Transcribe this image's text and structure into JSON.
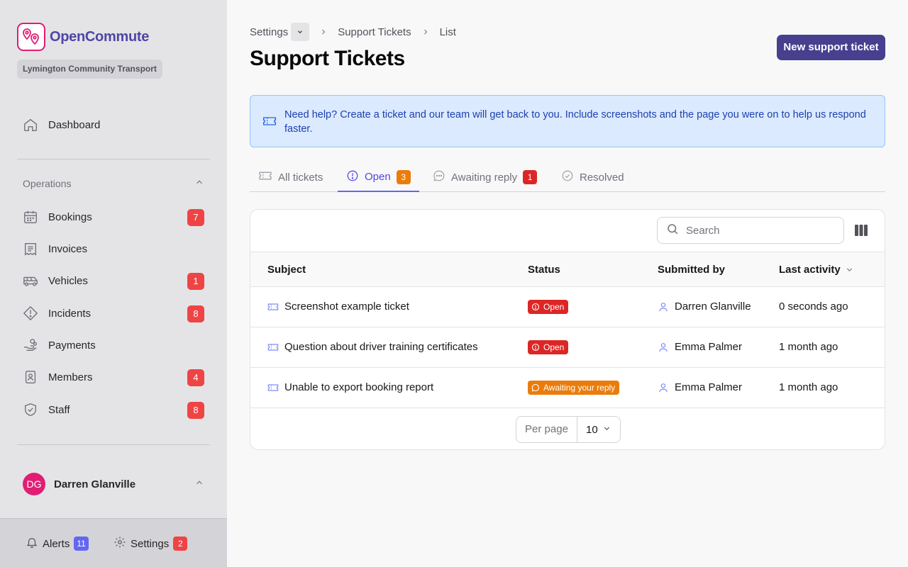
{
  "app": {
    "name": "OpenCommute",
    "organization": "Lymington Community Transport"
  },
  "sidebar": {
    "dashboard": {
      "label": "Dashboard"
    },
    "section_title": "Operations",
    "items": [
      {
        "label": "Bookings",
        "badge": "7"
      },
      {
        "label": "Invoices",
        "badge": ""
      },
      {
        "label": "Vehicles",
        "badge": "1"
      },
      {
        "label": "Incidents",
        "badge": "8"
      },
      {
        "label": "Payments",
        "badge": ""
      },
      {
        "label": "Members",
        "badge": "4"
      },
      {
        "label": "Staff",
        "badge": "8"
      }
    ],
    "user": {
      "initials": "DG",
      "name": "Darren Glanville"
    },
    "footer": {
      "alerts": {
        "label": "Alerts",
        "badge": "11"
      },
      "settings": {
        "label": "Settings",
        "badge": "2"
      }
    }
  },
  "breadcrumb": {
    "root": "Settings",
    "section": "Support Tickets",
    "current": "List"
  },
  "page": {
    "title": "Support Tickets",
    "new_button": "New support ticket"
  },
  "info": {
    "text": "Need help? Create a ticket and our team will get back to you. Include screenshots and the page you were on to help us respond faster."
  },
  "tabs": [
    {
      "label": "All tickets",
      "badge": ""
    },
    {
      "label": "Open",
      "badge": "3"
    },
    {
      "label": "Awaiting reply",
      "badge": "1"
    },
    {
      "label": "Resolved",
      "badge": ""
    }
  ],
  "table": {
    "search_placeholder": "Search",
    "columns": {
      "subject": "Subject",
      "status": "Status",
      "submitted_by": "Submitted by",
      "last_activity": "Last activity"
    },
    "rows": [
      {
        "subject": "Screenshot example ticket",
        "status": "Open",
        "submitted_by": "Darren Glanville",
        "last_activity": "0 seconds ago"
      },
      {
        "subject": "Question about driver training certificates",
        "status": "Open",
        "submitted_by": "Emma Palmer",
        "last_activity": "1 month ago"
      },
      {
        "subject": "Unable to export booking report",
        "status": "Awaiting your reply",
        "submitted_by": "Emma Palmer",
        "last_activity": "1 month ago"
      }
    ],
    "pagination": {
      "label": "Per page",
      "value": "10"
    }
  },
  "colors": {
    "brand": "#4f46a5",
    "logo_accent": "#e11d74",
    "primary_button": "#483f8f",
    "badge_red": "#ef4444",
    "status_open": "#dc2626",
    "status_awaiting": "#ea7c0c",
    "tab_active": "#4f46e5",
    "info_bg": "#dbeafe"
  },
  "icons": {
    "dashboard": "home-icon",
    "bookings": "calendar-icon",
    "invoices": "receipt-icon",
    "vehicles": "bus-icon",
    "incidents": "warning-icon",
    "payments": "hand-coins-icon",
    "members": "id-badge-icon",
    "staff": "shield-check-icon",
    "alerts": "bell-icon",
    "settings": "gear-icon",
    "ticket": "ticket-icon",
    "search": "search-icon",
    "columns": "columns-icon"
  }
}
